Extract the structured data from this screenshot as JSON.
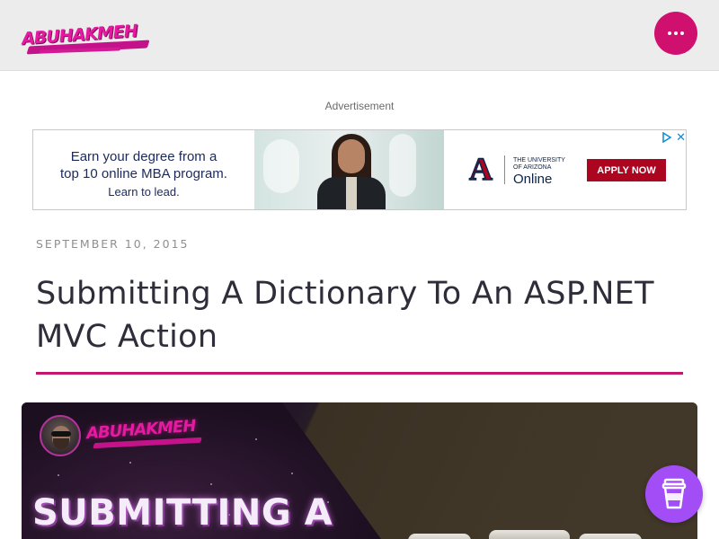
{
  "header": {
    "logo_text": "ABUHAKMEH",
    "menu_icon": "more-dots-icon",
    "accent": "#d0106e"
  },
  "ad": {
    "label": "Advertisement",
    "line1": "Earn your degree from a",
    "line2": "top 10 online MBA program.",
    "line3": "Learn to lead.",
    "university_small_line1": "THE UNIVERSITY",
    "university_small_line2": "OF ARIZONA",
    "university_online": "Online",
    "university_mark": "A",
    "cta": "APPLY NOW",
    "close": "✕",
    "choices_icon": "adchoices-icon"
  },
  "post": {
    "date": "SEPTEMBER 10, 2015",
    "title": "Submitting A Dictionary To An ASP.NET MVC Action",
    "rule_color": "#c4166e"
  },
  "hero": {
    "logo_text": "ABUHAKMEH",
    "heading": "SUBMITTING A"
  },
  "floating": {
    "coffee_icon": "coffee-cup-icon",
    "color": "#a24df6"
  }
}
